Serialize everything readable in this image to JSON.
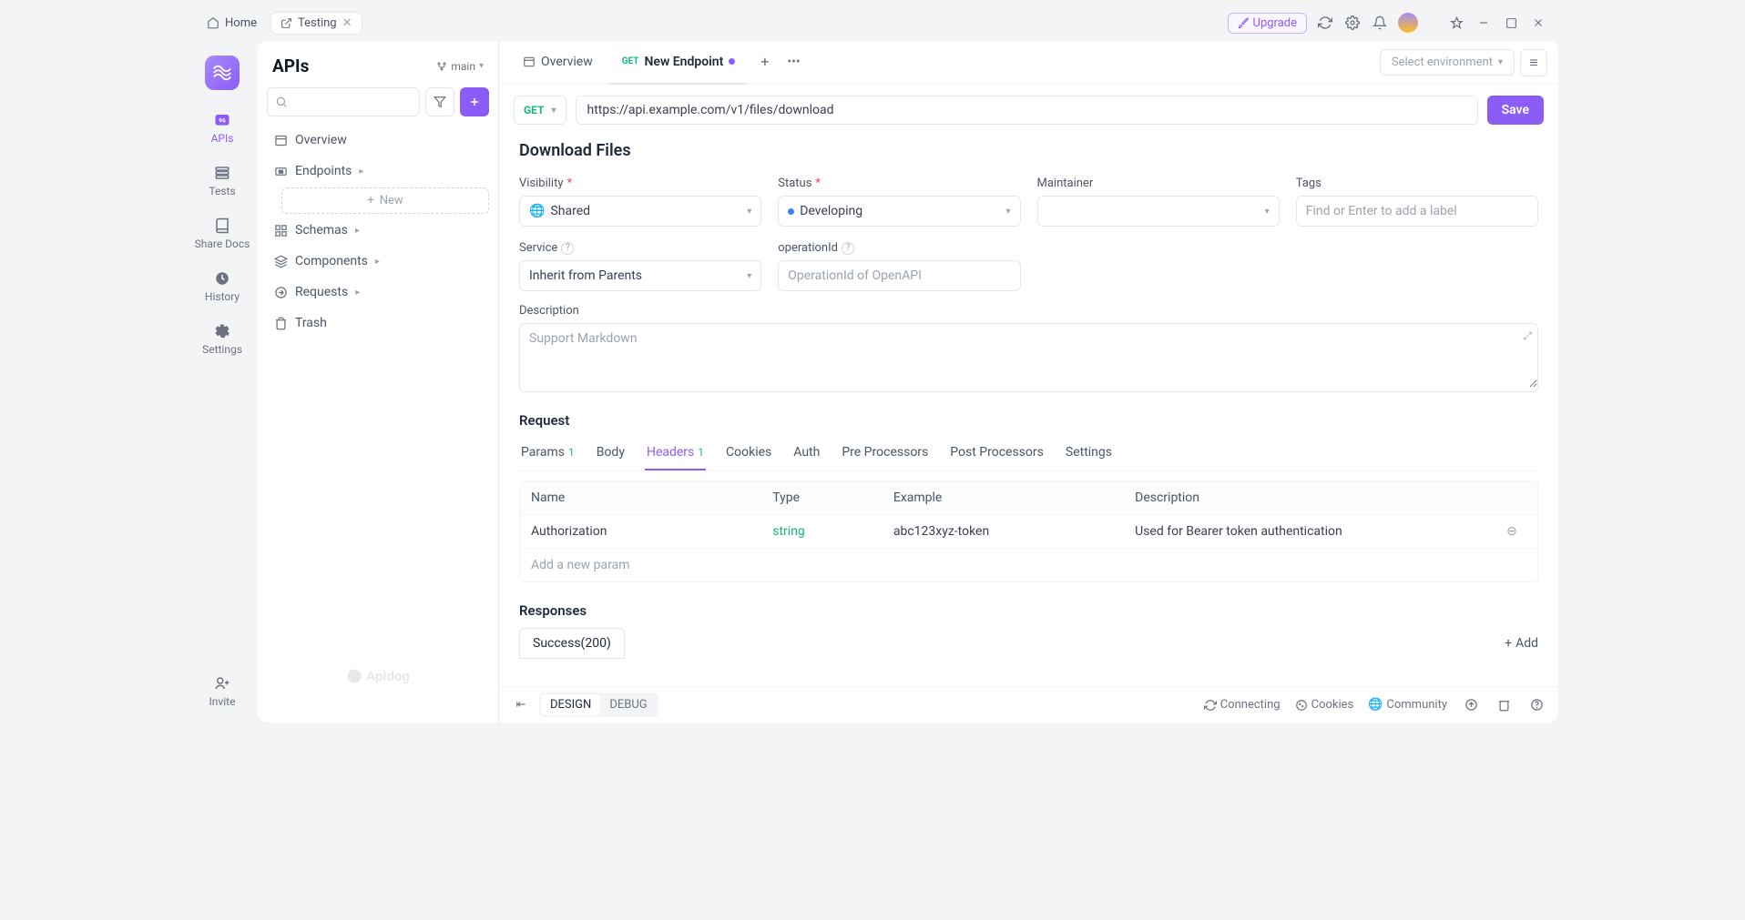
{
  "titlebar": {
    "home_tab": "Home",
    "active_tab": "Testing",
    "upgrade": "Upgrade"
  },
  "rail": {
    "apis": "APIs",
    "tests": "Tests",
    "share": "Share Docs",
    "history": "History",
    "settings": "Settings",
    "invite": "Invite"
  },
  "sidebar": {
    "title": "APIs",
    "branch": "main",
    "tree": {
      "overview": "Overview",
      "endpoints": "Endpoints",
      "new": "New",
      "schemas": "Schemas",
      "components": "Components",
      "requests": "Requests",
      "trash": "Trash"
    },
    "brand": "Apidog"
  },
  "doc_tabs": {
    "overview": "Overview",
    "new_endpoint_method": "GET",
    "new_endpoint_label": "New Endpoint",
    "env_placeholder": "Select environment"
  },
  "url_row": {
    "method": "GET",
    "url": "https://api.example.com/v1/files/download",
    "save": "Save"
  },
  "endpoint": {
    "title": "Download Files",
    "labels": {
      "visibility": "Visibility",
      "status": "Status",
      "maintainer": "Maintainer",
      "tags": "Tags",
      "service": "Service",
      "operationId": "operationId",
      "description": "Description"
    },
    "values": {
      "visibility": "Shared",
      "status": "Developing",
      "service": "Inherit from Parents"
    },
    "placeholders": {
      "tags": "Find or Enter to add a label",
      "operationId": "OperationId of OpenAPI",
      "description": "Support Markdown"
    }
  },
  "request": {
    "heading": "Request",
    "tabs": {
      "params": "Params",
      "params_count": "1",
      "body": "Body",
      "headers": "Headers",
      "headers_count": "1",
      "cookies": "Cookies",
      "auth": "Auth",
      "pre": "Pre Processors",
      "post": "Post Processors",
      "settings": "Settings"
    },
    "columns": {
      "name": "Name",
      "type": "Type",
      "example": "Example",
      "description": "Description"
    },
    "rows": [
      {
        "name": "Authorization",
        "type": "string",
        "example": "abc123xyz-token",
        "description": "Used for Bearer token authentication"
      }
    ],
    "add_placeholder": "Add a new param"
  },
  "responses": {
    "heading": "Responses",
    "success": "Success(200)",
    "add": "Add"
  },
  "footer": {
    "design": "DESIGN",
    "debug": "DEBUG",
    "connecting": "Connecting",
    "cookies": "Cookies",
    "community": "Community"
  }
}
